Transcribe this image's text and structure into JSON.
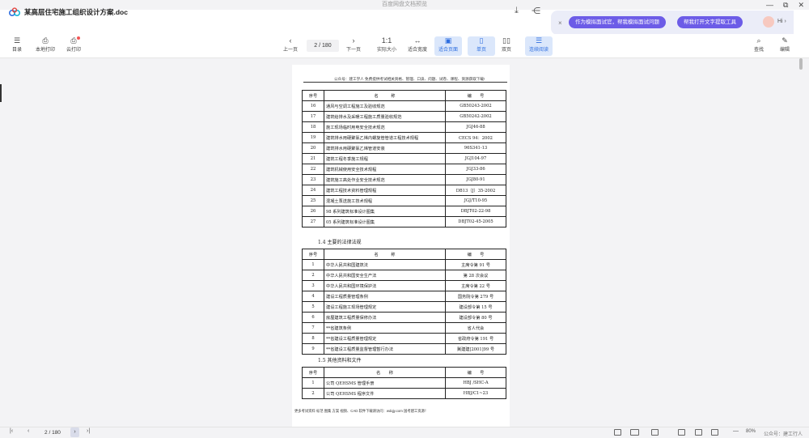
{
  "window": {
    "title": "百度网盘文档预览",
    "controls": [
      "—",
      "⧉",
      "✕"
    ]
  },
  "header": {
    "filename": "某高层住宅施工组织设计方案.doc",
    "ai": {
      "close": "×",
      "pill1": "作为模拟面试官，帮我模拟面试问题",
      "pill2": "帮我打开文字提取工具",
      "hi": "Hi ›"
    }
  },
  "toolbar": {
    "left": [
      {
        "label": "目录",
        "icon": "☰"
      },
      {
        "label": "本地打印",
        "icon": "⎙"
      },
      {
        "label": "云打印",
        "icon": "⎙"
      }
    ],
    "prev": {
      "label": "上一页",
      "icon": "‹"
    },
    "page_value": "2 / 180",
    "next": {
      "label": "下一页",
      "icon": "›"
    },
    "view": [
      {
        "label": "实际大小",
        "icon": "1:1"
      },
      {
        "label": "适合宽度",
        "icon": "↔"
      },
      {
        "label": "适合页面",
        "icon": "▣"
      },
      {
        "label": "单页",
        "icon": "▯"
      },
      {
        "label": "双页",
        "icon": "▯▯"
      },
      {
        "label": "连续阅读",
        "icon": "☰"
      }
    ],
    "right": [
      {
        "label": "查找",
        "icon": "⌕"
      },
      {
        "label": "编辑",
        "icon": "✎"
      }
    ]
  },
  "document": {
    "header_text": "公众号：建工学人  免费提供考试相关资格、管理、口诀、问题、试卷、课程、资源获取下载!",
    "table1": {
      "head": [
        "序号",
        "名　　　称",
        "编　　号"
      ],
      "rows": [
        [
          "16",
          "通风与空调工程施工及验收规范",
          "GB50243-2002"
        ],
        [
          "17",
          "建筑给排水及采暖工程施工质量验收规范",
          "GB50242-2002"
        ],
        [
          "18",
          "施工现场临时用电安全技术规范",
          "JGJ46-88"
        ],
        [
          "19",
          "建筑排水用硬聚氯乙烯内螺旋管管道工程技术规程",
          "CECS 94：2002"
        ],
        [
          "20",
          "建筑排水用硬聚氯乙烯管道安装",
          "96S341-13"
        ],
        [
          "21",
          "建筑工程冬季施工规程",
          "JGJ104-97"
        ],
        [
          "22",
          "建筑机械使用安全技术规程",
          "JGJ33-86"
        ],
        [
          "23",
          "建筑施工高处作业安全技术规范",
          "JGJ80-91"
        ],
        [
          "24",
          "建筑工程技术资料管理规程",
          "DB13（J）35-2002"
        ],
        [
          "25",
          "混凝土泵送施工技术规程",
          "JGJ/T10-95"
        ],
        [
          "26",
          "98 系列建筑标准设计图集",
          "DBJT02-22-98"
        ],
        [
          "27",
          "05 系列建筑标准设计图集",
          "DBJT02-45-2005"
        ]
      ]
    },
    "section1": "1.4 主要的法律法规",
    "table2": {
      "head": [
        "序号",
        "名　　　称",
        "编　　号"
      ],
      "rows": [
        [
          "1",
          "中华人民共和国建筑法",
          "主席令第 91 号"
        ],
        [
          "2",
          "中华人民共和国安全生产法",
          "第 28 次会议"
        ],
        [
          "3",
          "中华人民共和国环境保护法",
          "主席令第 22 号"
        ],
        [
          "4",
          "建设工程质量管理条例",
          "国务院令第 279 号"
        ],
        [
          "5",
          "建设工程施工现场管理规定",
          "建设部令第 15 号"
        ],
        [
          "6",
          "房屋建筑工程质量保修办法",
          "建设部令第 80 号"
        ],
        [
          "7",
          "**省建筑条例",
          "省人代会"
        ],
        [
          "8",
          "**省建设工程质量管理规定",
          "省政府令第 191 号"
        ],
        [
          "9",
          "**省建设工程质量监督管理暂行办法",
          "冀建建[2001]99 号"
        ]
      ]
    },
    "section2": "1.5 其他资料和文件",
    "table3": {
      "head": [
        "序号",
        "名　　称",
        "编　　号"
      ],
      "rows": [
        [
          "1",
          "公司 QEHSMS 管理手册",
          "HBJ /SHC-A"
        ],
        [
          "2",
          "公司 QEHSMS 程序文件",
          "HBJ/C1~23"
        ]
      ]
    },
    "footer_text": "更多考试资料 标范 图集 方案 视频、CAD 软件下载请访问：wdqjy.com 国考建工资源！"
  },
  "bottom": {
    "first": "|‹",
    "prev": "‹",
    "page": "2 / 180",
    "next": "›",
    "last": "›|",
    "zoom_minus": "—",
    "zoom": "80%",
    "zoom_plus": "+",
    "watermark": "公众号：建工行人"
  }
}
